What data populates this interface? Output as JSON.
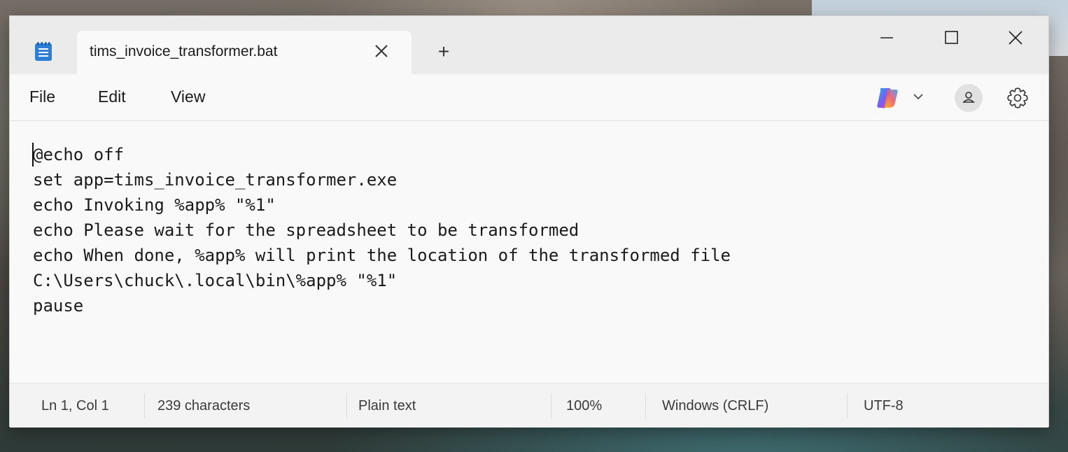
{
  "app": {
    "icon": "notepad-icon",
    "tab_title": "tims_invoice_transformer.bat",
    "new_tab_label": "+"
  },
  "menu": {
    "file": "File",
    "edit": "Edit",
    "view": "View"
  },
  "toolbar": {
    "copilot_icon": "copilot-icon",
    "profile_icon": "profile-icon",
    "settings_icon": "gear-icon"
  },
  "editor": {
    "lines": [
      "@echo off",
      "set app=tims_invoice_transformer.exe",
      "echo Invoking %app% \"%1\"",
      "echo Please wait for the spreadsheet to be transformed",
      "echo When done, %app% will print the location of the transformed file",
      "C:\\Users\\chuck\\.local\\bin\\%app% \"%1\"",
      "pause"
    ]
  },
  "status": {
    "position": "Ln 1, Col 1",
    "characters": "239 characters",
    "format": "Plain text",
    "zoom": "100%",
    "line_endings": "Windows (CRLF)",
    "encoding": "UTF-8"
  }
}
